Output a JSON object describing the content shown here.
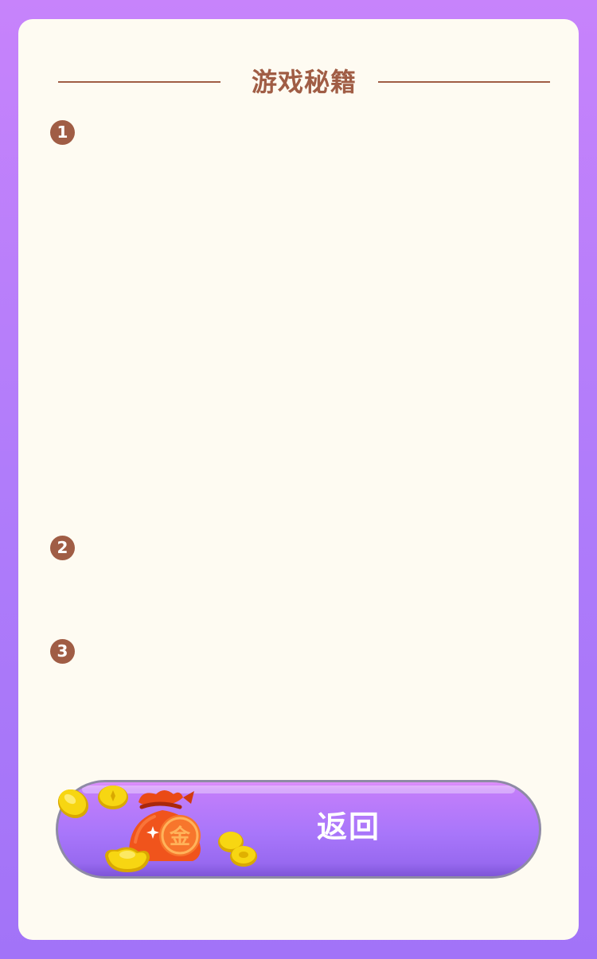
{
  "modal": {
    "title": "游戏秘籍",
    "steps": [
      "1",
      "2",
      "3"
    ],
    "back_button_label": "返回",
    "money_bag_char": "金"
  },
  "colors": {
    "background_top": "#c783fb",
    "background_bottom": "#a273f8",
    "card": "#fefbf2",
    "title": "#a05d45",
    "button_top": "#c37efa",
    "button_bottom": "#9869f0",
    "money_bag": "#f0541c",
    "coin": "#f5d00a"
  },
  "icons": [
    "money-bag-icon",
    "gold-coin-icon",
    "gold-ingot-icon"
  ]
}
